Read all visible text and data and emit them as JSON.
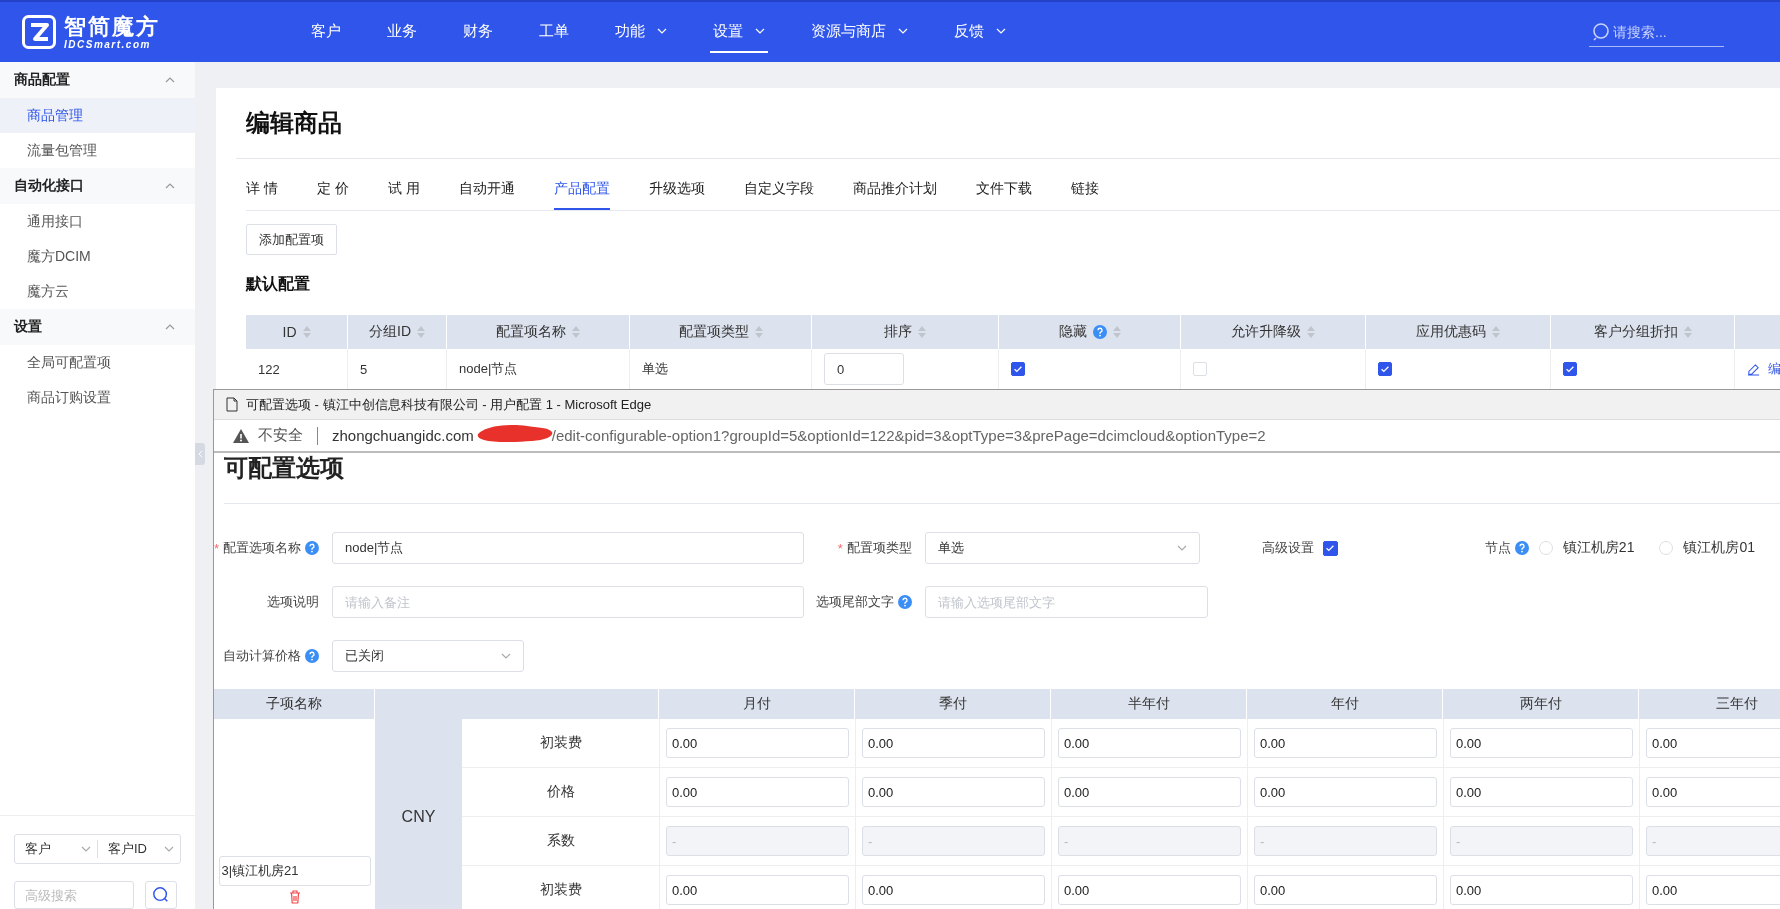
{
  "header": {
    "logo_title": "智简魔方",
    "logo_subtitle": "IDCSmart.com",
    "nav": [
      {
        "label": "客户",
        "dropdown": false,
        "selected": false
      },
      {
        "label": "业务",
        "dropdown": false,
        "selected": false
      },
      {
        "label": "财务",
        "dropdown": false,
        "selected": false
      },
      {
        "label": "工单",
        "dropdown": false,
        "selected": false
      },
      {
        "label": "功能",
        "dropdown": true,
        "selected": false
      },
      {
        "label": "设置",
        "dropdown": true,
        "selected": true
      },
      {
        "label": "资源与商店",
        "dropdown": true,
        "selected": false
      },
      {
        "label": "反馈",
        "dropdown": true,
        "selected": false
      }
    ],
    "search": {
      "placeholder": "请搜索..."
    }
  },
  "sidebar": {
    "groups": [
      {
        "title": "商品配置",
        "expanded": true,
        "items": [
          {
            "label": "商品管理",
            "selected": true
          },
          {
            "label": "流量包管理",
            "selected": false
          }
        ]
      },
      {
        "title": "自动化接口",
        "expanded": true,
        "items": [
          {
            "label": "通用接口",
            "selected": false
          },
          {
            "label": "魔方DCIM",
            "selected": false
          },
          {
            "label": "魔方云",
            "selected": false
          }
        ]
      },
      {
        "title": "设置",
        "expanded": true,
        "items": [
          {
            "label": "全局可配置项",
            "selected": false
          },
          {
            "label": "商品订购设置",
            "selected": false
          }
        ]
      }
    ],
    "filter": {
      "scope": "客户",
      "field": "客户ID",
      "placeholder": "高级搜索"
    }
  },
  "page": {
    "title": "编辑商品",
    "tabs": [
      {
        "label": "详 情",
        "selected": false
      },
      {
        "label": "定 价",
        "selected": false
      },
      {
        "label": "试 用",
        "selected": false
      },
      {
        "label": "自动开通",
        "selected": false
      },
      {
        "label": "产品配置",
        "selected": true
      },
      {
        "label": "升级选项",
        "selected": false
      },
      {
        "label": "自定义字段",
        "selected": false
      },
      {
        "label": "商品推介计划",
        "selected": false
      },
      {
        "label": "文件下载",
        "selected": false
      },
      {
        "label": "链接",
        "selected": false
      }
    ],
    "add_button": "添加配置项",
    "section_title": "默认配置",
    "table": {
      "columns": [
        {
          "label": "ID",
          "sortable": true,
          "help": false
        },
        {
          "label": "分组ID",
          "sortable": true,
          "help": false
        },
        {
          "label": "配置项名称",
          "sortable": true,
          "help": false
        },
        {
          "label": "配置项类型",
          "sortable": true,
          "help": false
        },
        {
          "label": "排序",
          "sortable": true,
          "help": false
        },
        {
          "label": "隐藏",
          "sortable": true,
          "help": true
        },
        {
          "label": "允许升降级",
          "sortable": true,
          "help": false
        },
        {
          "label": "应用优惠码",
          "sortable": true,
          "help": false
        },
        {
          "label": "客户分组折扣",
          "sortable": true,
          "help": false
        }
      ],
      "rows": [
        {
          "cells": [
            {
              "kind": "text",
              "text": "122"
            },
            {
              "kind": "text",
              "text": "5"
            },
            {
              "kind": "text",
              "text": "node|节点"
            },
            {
              "kind": "text",
              "text": "单选"
            },
            {
              "kind": "input",
              "value": "0"
            },
            {
              "kind": "checkbox",
              "checked": true
            },
            {
              "kind": "checkbox",
              "checked": false
            },
            {
              "kind": "checkbox",
              "checked": true
            },
            {
              "kind": "checkbox",
              "checked": true
            },
            {
              "kind": "link",
              "text": "编"
            }
          ]
        }
      ]
    }
  },
  "popup": {
    "title": "可配置选项 - 镇江中创信息科技有限公司 - 用户配置 1 - Microsoft Edge",
    "security": "不安全",
    "url_host": "zhongchuangidc.com",
    "url_path": "/edit-configurable-option1?groupId=5&optionId=122&pid=3&optType=3&prePage=dcimcloud&optionType=2",
    "heading": "可配置选项",
    "form": {
      "name": {
        "label": "配置选项名称",
        "required_mark": "*",
        "help": true,
        "value": "node|节点"
      },
      "type": {
        "label": "配置项类型",
        "required_mark": "*",
        "value": "单选"
      },
      "advanced": {
        "label": "高级设置",
        "checked": true
      },
      "node": {
        "label": "节点",
        "help": true,
        "options": [
          {
            "label": "镇江机房21",
            "selected": false
          },
          {
            "label": "镇江机房01",
            "selected": false
          }
        ]
      },
      "description": {
        "label": "选项说明",
        "placeholder": "请输入备注"
      },
      "suffix": {
        "label": "选项尾部文字",
        "help": true,
        "placeholder": "请输入选项尾部文字"
      },
      "auto_price": {
        "label": "自动计算价格",
        "help": true,
        "value": "已关闭"
      }
    },
    "price_table": {
      "name_header": "子项名称",
      "periods": [
        "月付",
        "季付",
        "半年付",
        "年付",
        "两年付",
        "三年付"
      ],
      "items": [
        {
          "name": "3|镇江机房21",
          "currency": "CNY",
          "rows": [
            {
              "label": "初装费",
              "disabled": false,
              "values": [
                "0.00",
                "0.00",
                "0.00",
                "0.00",
                "0.00",
                "0.00"
              ]
            },
            {
              "label": "价格",
              "disabled": false,
              "values": [
                "0.00",
                "0.00",
                "0.00",
                "0.00",
                "0.00",
                "0.00"
              ]
            },
            {
              "label": "系数",
              "disabled": true,
              "values": [
                "-",
                "-",
                "-",
                "-",
                "-",
                "-"
              ]
            },
            {
              "label": "初装费",
              "disabled": false,
              "values": [
                "0.00",
                "0.00",
                "0.00",
                "0.00",
                "0.00",
                "0.00"
              ]
            }
          ]
        }
      ]
    }
  }
}
